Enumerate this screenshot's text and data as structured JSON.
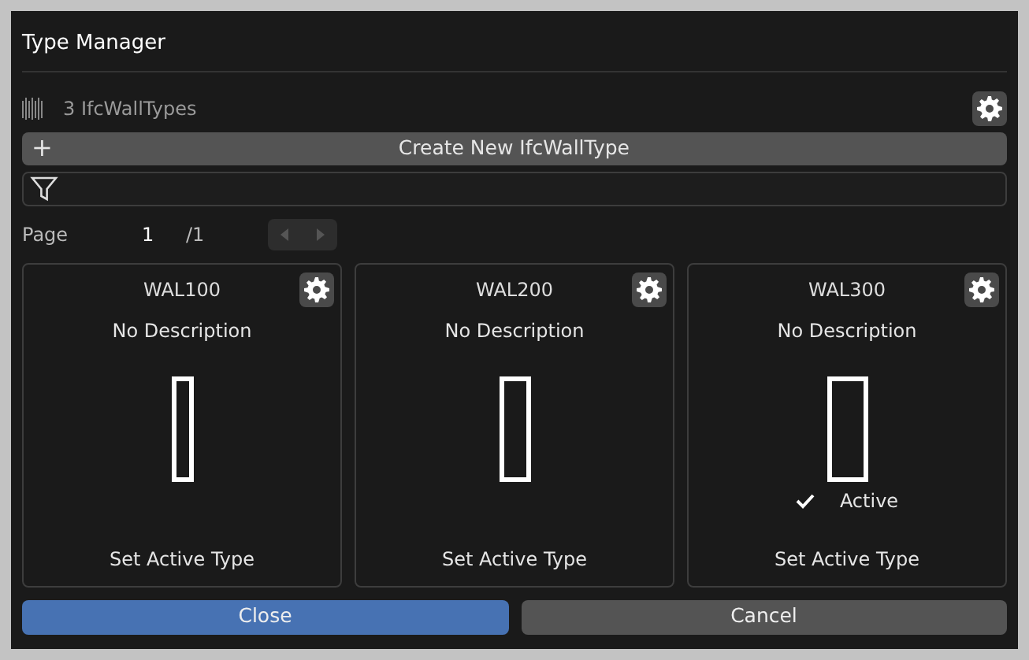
{
  "window": {
    "title": "Type Manager"
  },
  "summary": {
    "count_label": "3 IfcWallTypes"
  },
  "create_button": {
    "label": "+",
    "text": "Create New IfcWallType"
  },
  "pager": {
    "label": "Page",
    "current": "1",
    "total": "/1",
    "prev_disabled": true,
    "next_disabled": true
  },
  "types": [
    {
      "name": "WAL100",
      "description": "No Description",
      "active": false,
      "action": "Set Active Type"
    },
    {
      "name": "WAL200",
      "description": "No Description",
      "active": false,
      "action": "Set Active Type"
    },
    {
      "name": "WAL300",
      "description": "No Description",
      "active": true,
      "active_label": "Active",
      "action": "Set Active Type"
    }
  ],
  "buttons": [
    {
      "label": "Close",
      "kind": "primary"
    },
    {
      "label": "Cancel",
      "kind": "secondary"
    }
  ]
}
